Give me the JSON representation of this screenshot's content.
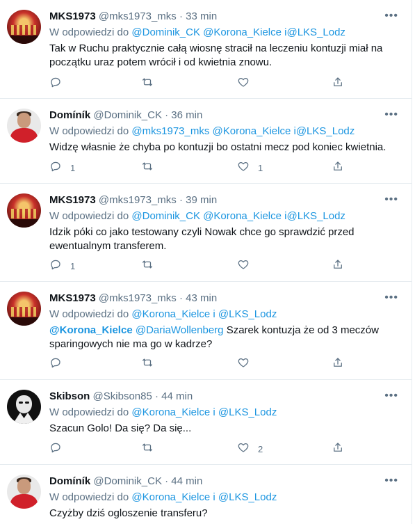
{
  "tweets": [
    {
      "name": "MKS1973",
      "meta": "@mks1973_mks · 33 min",
      "reply_prefix": "W odpowiedzi do ",
      "reply_to": [
        "@Dominik_CK",
        "@Korona_Kielce",
        "i",
        "@LKS_Lodz"
      ],
      "text_lines": [
        "Tak w Ruchu praktycznie całą wiosnę stracił na leczeniu kontuzji miał na",
        "początku uraz potem wrócił i od kwietnia znowu."
      ],
      "reply_count": "",
      "like_count": "",
      "avatar": "crowd"
    },
    {
      "name": "Domíník",
      "meta": "@Dominik_CK · 36 min",
      "reply_prefix": "W odpowiedzi do ",
      "reply_to": [
        "@mks1973_mks",
        "@Korona_Kielce",
        "i",
        "@LKS_Lodz"
      ],
      "text_lines": [
        "Widzę własnie że chyba po kontuzji bo ostatni mecz pod koniec kwietnia."
      ],
      "reply_count": "1",
      "like_count": "1",
      "avatar": "person"
    },
    {
      "name": "MKS1973",
      "meta": "@mks1973_mks · 39 min",
      "reply_prefix": "W odpowiedzi do ",
      "reply_to": [
        "@Dominik_CK",
        "@Korona_Kielce",
        "i",
        "@LKS_Lodz"
      ],
      "text_lines": [
        "Idzik póki co jako testowany czyli Nowak chce go sprawdzić przed",
        "ewentualnym transferem."
      ],
      "reply_count": "1",
      "like_count": "",
      "avatar": "crowd"
    },
    {
      "name": "MKS1973",
      "meta": "@mks1973_mks · 43 min",
      "reply_prefix": "W odpowiedzi do ",
      "reply_to": [
        "@Korona_Kielce",
        "i",
        "@LKS_Lodz"
      ],
      "mention": "@Korona_Kielce",
      "mention2": "@DariaWollenberg",
      "text_lines": [
        "Szarek kontuzja że od 3 meczów",
        "sparingowych nie ma go w kadrze?"
      ],
      "reply_count": "",
      "like_count": "",
      "avatar": "crowd"
    },
    {
      "name": "Skibson",
      "meta": "@Skibson85 · 44 min",
      "reply_prefix": "W odpowiedzi do ",
      "reply_to": [
        "@Korona_Kielce",
        "i",
        "@LKS_Lodz"
      ],
      "text_lines": [
        "Szacun Golo! Da się? Da się..."
      ],
      "reply_count": "",
      "like_count": "2",
      "avatar": "dark"
    },
    {
      "name": "Domíník",
      "meta": "@Dominik_CK · 44 min",
      "reply_prefix": "W odpowiedzi do ",
      "reply_to": [
        "@Korona_Kielce",
        "i",
        "@LKS_Lodz"
      ],
      "text_lines": [
        "Czyżby dziś ogloszenie transferu?"
      ],
      "reply_count": "",
      "like_count": "",
      "avatar": "person"
    }
  ],
  "colors": {
    "link": "#1b95e0",
    "muted": "#5b7083",
    "text": "#0f1419",
    "border": "#e6ecf0"
  },
  "icons": {
    "reply": "reply-icon",
    "retweet": "retweet-icon",
    "like": "heart-icon",
    "share": "share-icon",
    "more": "more-icon"
  }
}
